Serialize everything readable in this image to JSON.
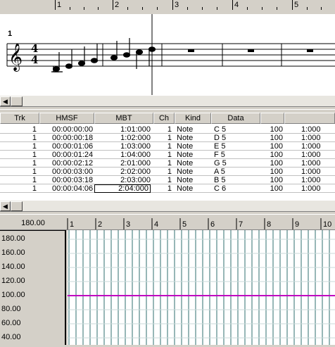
{
  "top_ruler": {
    "measures": [
      "1",
      "2",
      "3",
      "4",
      "5"
    ]
  },
  "staff": {
    "measure_number": "1",
    "time_sig_top": "4",
    "time_sig_bottom": "4"
  },
  "event_list": {
    "columns": [
      "Trk",
      "HMSF",
      "MBT",
      "Ch",
      "Kind",
      "Data",
      "",
      ""
    ],
    "rows": [
      {
        "trk": "1",
        "hmsf": "00:00:00:00",
        "mbt": "1:01:000",
        "ch": "1",
        "kind": "Note",
        "data": "C 5",
        "vel": "100",
        "dur": "1:000"
      },
      {
        "trk": "1",
        "hmsf": "00:00:00:18",
        "mbt": "1:02:000",
        "ch": "1",
        "kind": "Note",
        "data": "D 5",
        "vel": "100",
        "dur": "1:000"
      },
      {
        "trk": "1",
        "hmsf": "00:00:01:06",
        "mbt": "1:03:000",
        "ch": "1",
        "kind": "Note",
        "data": "E 5",
        "vel": "100",
        "dur": "1:000"
      },
      {
        "trk": "1",
        "hmsf": "00:00:01:24",
        "mbt": "1:04:000",
        "ch": "1",
        "kind": "Note",
        "data": "F 5",
        "vel": "100",
        "dur": "1:000"
      },
      {
        "trk": "1",
        "hmsf": "00:00:02:12",
        "mbt": "2:01:000",
        "ch": "1",
        "kind": "Note",
        "data": "G 5",
        "vel": "100",
        "dur": "1:000"
      },
      {
        "trk": "1",
        "hmsf": "00:00:03:00",
        "mbt": "2:02:000",
        "ch": "1",
        "kind": "Note",
        "data": "A 5",
        "vel": "100",
        "dur": "1:000"
      },
      {
        "trk": "1",
        "hmsf": "00:00:03:18",
        "mbt": "2:03:000",
        "ch": "1",
        "kind": "Note",
        "data": "B 5",
        "vel": "100",
        "dur": "1:000"
      },
      {
        "trk": "1",
        "hmsf": "00:00:04:06",
        "mbt": "2:04:000",
        "ch": "1",
        "kind": "Note",
        "data": "C 6",
        "vel": "100",
        "dur": "1:000"
      }
    ],
    "selected_row": 7
  },
  "tempo": {
    "current": "180.00",
    "ruler": [
      "1",
      "2",
      "3",
      "4",
      "5",
      "6",
      "7",
      "8",
      "9",
      "10"
    ],
    "axis_labels": [
      "180.00",
      "160.00",
      "140.00",
      "120.00",
      "100.00",
      "80.00",
      "60.00",
      "40.00"
    ],
    "tempo_value": 100,
    "line_color": "#c000c0",
    "grid_color": "#2f6f6f"
  }
}
